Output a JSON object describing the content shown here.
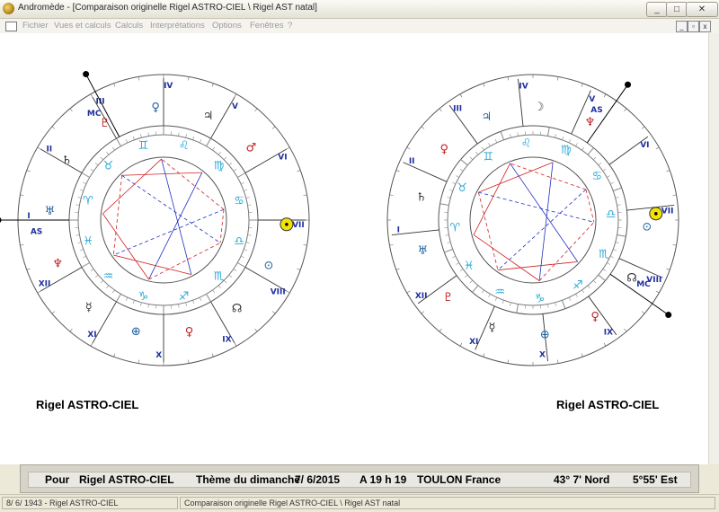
{
  "window": {
    "title": "Andromède - [Comparaison originelle Rigel ASTRO-CIEL \\ Rigel AST natal]",
    "minimize": "_",
    "maximize": "□",
    "close": "✕"
  },
  "menu": {
    "items": [
      "Fichier",
      "Vues et calculs",
      "Calculs",
      "Interprétations",
      "Options",
      "Fenêtres",
      "?"
    ],
    "mdi_minimize": "_",
    "mdi_restore": "▫",
    "mdi_close": "x"
  },
  "charts": {
    "left": {
      "name": "Rigel ASTRO-CIEL",
      "angles": {
        "mc": "MC",
        "as": "AS"
      },
      "houses": [
        "I",
        "II",
        "III",
        "IV",
        "V",
        "VI",
        "VII",
        "VIII",
        "IX",
        "X",
        "XI",
        "XII"
      ],
      "signs": [
        "♋",
        "♍",
        "♌",
        "♊",
        "♉",
        "♈",
        "♓",
        "♒",
        "♑",
        "♐",
        "♏",
        "♎"
      ],
      "planets": [
        "♂",
        "♃",
        "♀",
        "♇",
        "♄",
        "♅",
        "♆",
        "☿",
        "⊕",
        "♀",
        "☊",
        "⊙"
      ],
      "sun_label": "⊙"
    },
    "right": {
      "name": "Rigel ASTRO-CIEL",
      "angles": {
        "mc": "MC",
        "as": "AS"
      },
      "houses": [
        "I",
        "II",
        "III",
        "IV",
        "V",
        "VI",
        "VII",
        "VIII",
        "IX",
        "X",
        "XI",
        "XII"
      ],
      "signs": [
        "♋",
        "♍",
        "♌",
        "♊",
        "♉",
        "♈",
        "♓",
        "♒",
        "♑",
        "♐",
        "♏",
        "♎"
      ],
      "planets": [
        "♆",
        "☽",
        "♃",
        "♀",
        "♄",
        "♅",
        "♇",
        "☿",
        "⊕",
        "♀",
        "☊",
        "⊙"
      ],
      "sun_label": "⊙"
    }
  },
  "info": {
    "prefix": "Pour",
    "name": "Rigel ASTRO-CIEL",
    "theme": "Thème du dimanche",
    "date": "7/ 6/2015",
    "time": "A 19 h 19",
    "place": "TOULON France",
    "latitude": "43° 7' Nord",
    "longitude": "5°55' Est"
  },
  "status": {
    "left": "8/ 6/ 1943 - Rigel ASTRO-CIEL",
    "right": "Comparaison originelle Rigel ASTRO-CIEL \\ Rigel AST natal"
  },
  "colors": {
    "house_numeral": "#1f2fa0",
    "sign": "#2aa8d8",
    "aspect_red": "#d02020",
    "aspect_blue": "#2030c0",
    "sun_disc": "#f2e300"
  }
}
